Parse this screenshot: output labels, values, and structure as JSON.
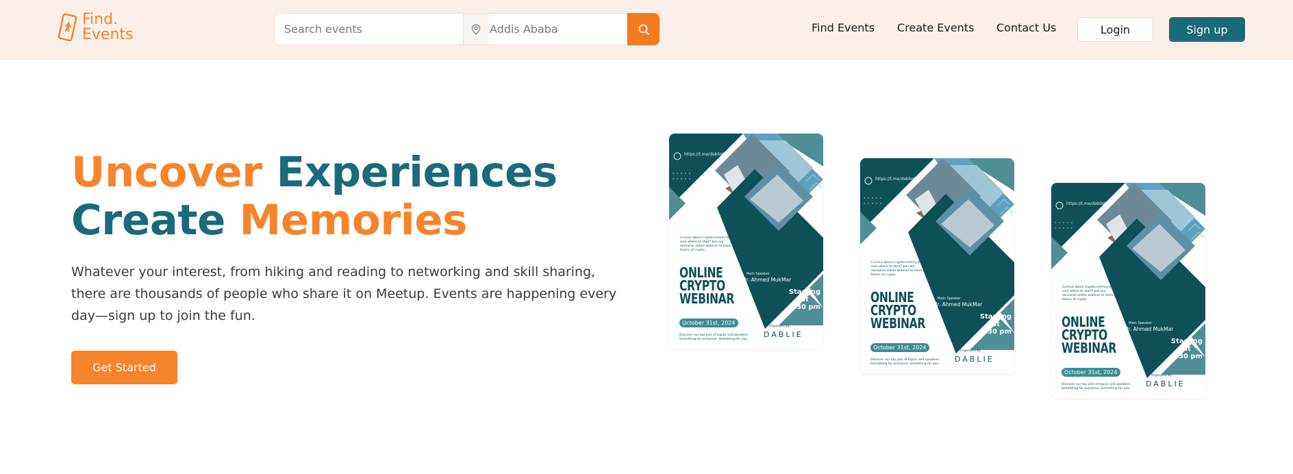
{
  "header": {
    "logo": {
      "line1": "Find.",
      "line2": "Events"
    },
    "search": {
      "placeholder": "Search events",
      "location_placeholder": "Addis Ababa"
    },
    "nav": [
      {
        "label": "Find Events"
      },
      {
        "label": "Create Events"
      },
      {
        "label": "Contact Us"
      }
    ],
    "login_label": "Login",
    "signup_label": "Sign up"
  },
  "hero": {
    "title_line1_a": "Uncover",
    "title_line1_b": "Experiences",
    "title_line2_a": "Create",
    "title_line2_b": "Memories",
    "description": "Whatever your interest, from hiking and reading to networking and skill sharing, there are thousands of people who share it on Meetup. Events are happening every day—sign up to join the fun.",
    "cta_label": "Get Started"
  },
  "poster": {
    "link": "https://t.me/dablietech",
    "blurb": "Curious about cryptocurrency but not sure where to start? Join our exclusive online webinar to learn the basics of crypto.",
    "title_line1": "ONLINE",
    "title_line2": "CRYPTO",
    "title_line3": "WEBINAR",
    "speaker_label": "Main Speaker",
    "speaker_name": "Mr. Ahmed MukMar",
    "time_line1": "Starting at",
    "time_line2": "8:30 pm",
    "date": "October 31st, 2024",
    "footer": "Discover our top pick of topics and speakers. Something for everyone. Something for you.",
    "organizer_label": "Organized By",
    "brand": "DABLIE"
  },
  "colors": {
    "brand_orange": "#F7842A",
    "brand_teal": "#1A6A7A",
    "header_bg": "#FBF0E9",
    "poster_dark": "#0E4F58"
  }
}
